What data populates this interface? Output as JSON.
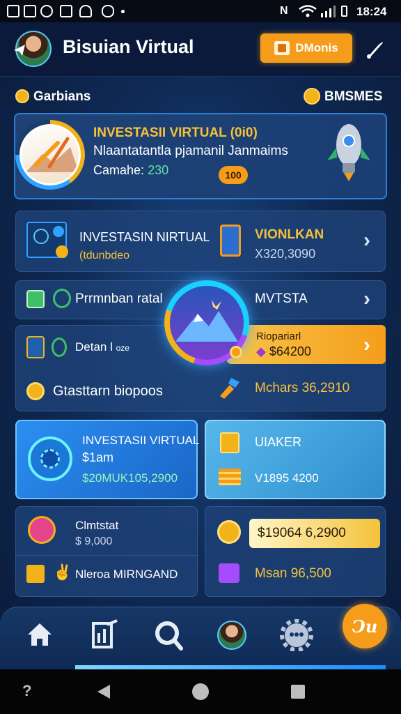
{
  "status_bar": {
    "time": "18:24",
    "network": "N"
  },
  "header": {
    "title": "Bisuian Virtual",
    "action_button_label": "DMonis"
  },
  "sections": {
    "left_label": "Garbians",
    "right_label": "BMSMES"
  },
  "hero": {
    "title": "INVESTASII VIRTUAL (0i0)",
    "subtitle": "Nlaantatantla pjamanil Janmaims",
    "detail_prefix": "Camahe:",
    "detail_value": "230",
    "badge": "100"
  },
  "row1": {
    "left_title": "INVESTASIN NIRTUAL",
    "left_sub": "(tdunbdeo",
    "right_title": "VIONLKAN",
    "right_value": "X320,3090"
  },
  "row2": {
    "left_label": "Prrmnban ratal",
    "right_label": "MVTSTA"
  },
  "row3": {
    "left_label": "Detan l",
    "left_tag": "oze",
    "orange_title": "Riopariarl",
    "orange_value": "$64200",
    "bottom_left": "Gtasttarn biopoos",
    "bottom_right": "Mchars 36,2910"
  },
  "blue_card": {
    "title": "INVESTASII VIRTUAL",
    "sub": "$1am",
    "value": "$20MUK105,2900"
  },
  "teal_card": {
    "title": "UIAKER",
    "value": "V1895 4200"
  },
  "small_left": {
    "title": "Clmtstat",
    "value": "$ 9,000",
    "bottom": "Nleroa MIRNGAND"
  },
  "small_right": {
    "pill": "$19064 6,2900",
    "bottom": "Msan 96,500"
  },
  "fab_label": "Ͻи",
  "colors": {
    "accent": "#f59c1a",
    "gold": "#f5c23a",
    "green": "#5fe3a4",
    "bg": "#0f2a55"
  }
}
